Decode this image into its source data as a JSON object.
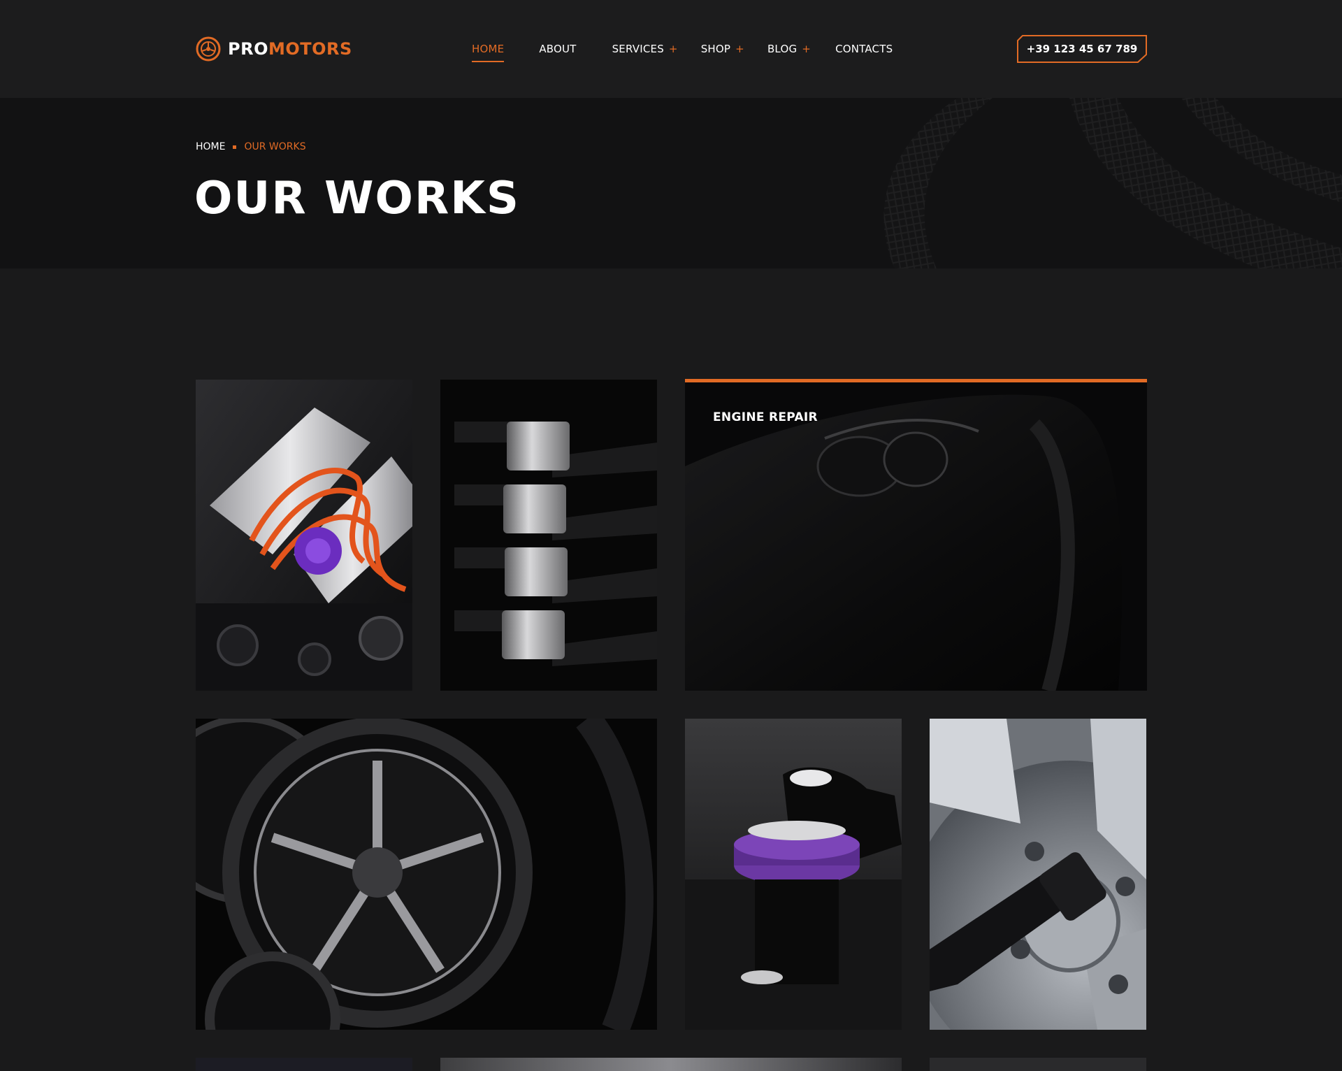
{
  "brand": {
    "part1": "PRO",
    "part2": "MOTORS"
  },
  "nav": {
    "home": "HOME",
    "about": "ABOUT",
    "services": "SERVICES",
    "shop": "SHOP",
    "blog": "BLOG",
    "contacts": "CONTACTS",
    "expand_symbol": "+"
  },
  "phone": "+39 123 45 67 789",
  "breadcrumb": {
    "home": "HOME",
    "current": "OUR WORKS"
  },
  "page_title": "OUR WORKS",
  "gallery": {
    "tiles": [
      {
        "subject": "engine-bay"
      },
      {
        "subject": "suspension-parts"
      },
      {
        "subject": "car-headlight",
        "caption": "ENGINE REPAIR"
      },
      {
        "subject": "alloy-wheels"
      },
      {
        "subject": "polishing-machine"
      },
      {
        "subject": "wheel-impact-wrench"
      },
      {
        "subject": "partial-image"
      },
      {
        "subject": "partial-image"
      },
      {
        "subject": "partial-image"
      }
    ]
  },
  "colors": {
    "accent": "#e26b25",
    "background": "#1a1a1b",
    "header": "#1c1c1d",
    "banner": "#121213",
    "text": "#ffffff"
  }
}
